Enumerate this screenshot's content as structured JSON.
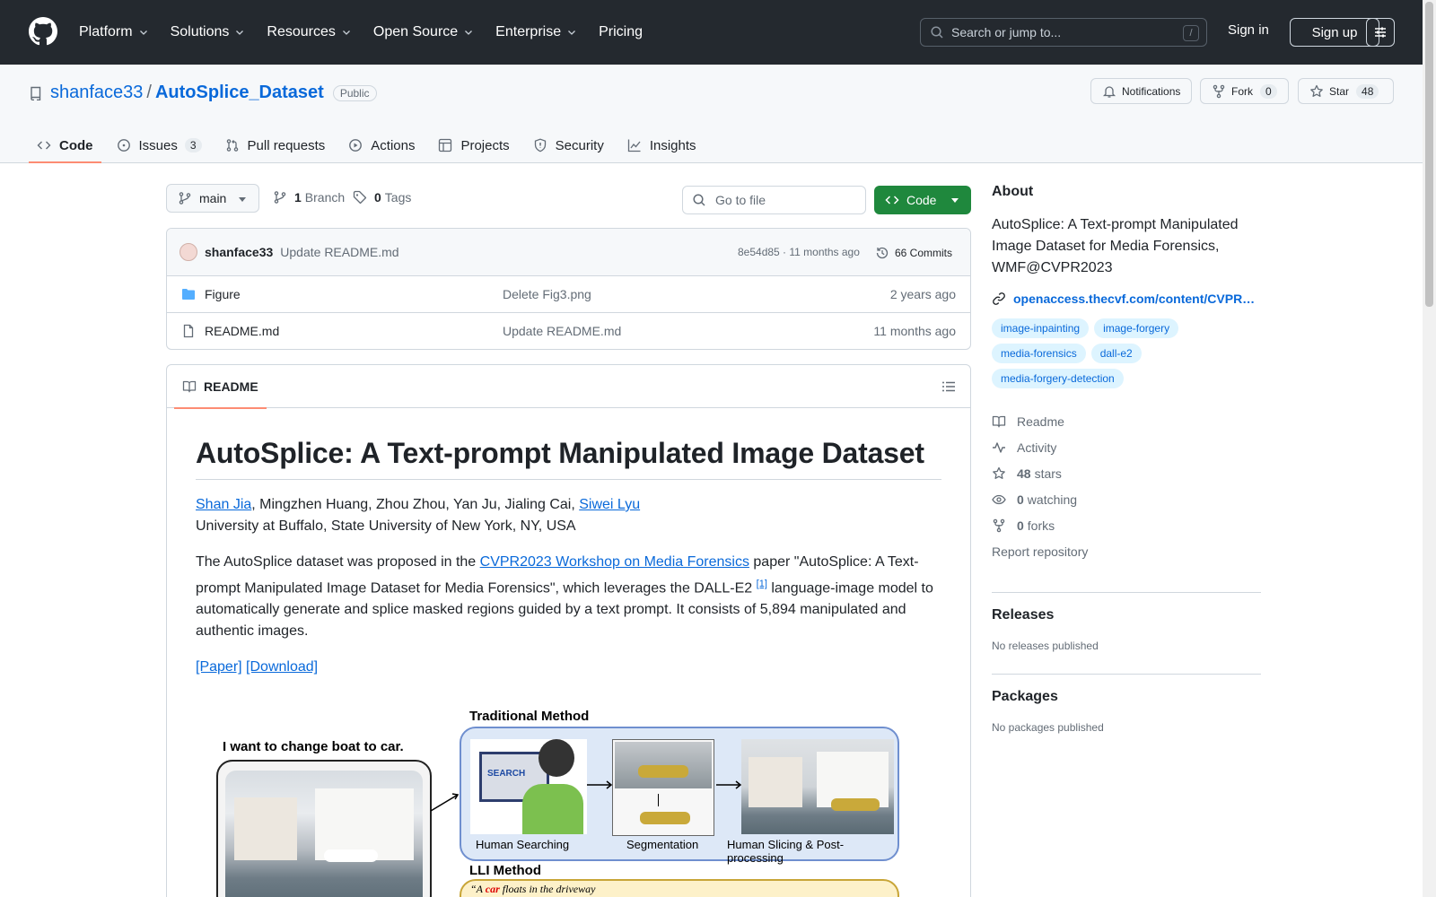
{
  "header": {
    "nav": [
      "Platform",
      "Solutions",
      "Resources",
      "Open Source",
      "Enterprise",
      "Pricing"
    ],
    "search_placeholder": "Search or jump to...",
    "search_shortcut": "/",
    "signin": "Sign in",
    "signup": "Sign up"
  },
  "repo": {
    "owner": "shanface33",
    "separator": "/",
    "name": "AutoSplice_Dataset",
    "visibility": "Public",
    "notifications_label": "Notifications",
    "fork_label": "Fork",
    "fork_count": "0",
    "star_label": "Star",
    "star_count": "48"
  },
  "tabs": [
    {
      "label": "Code",
      "icon": "code-icon"
    },
    {
      "label": "Issues",
      "icon": "issue-icon",
      "count": "3"
    },
    {
      "label": "Pull requests",
      "icon": "pull-request-icon"
    },
    {
      "label": "Actions",
      "icon": "play-icon"
    },
    {
      "label": "Projects",
      "icon": "table-icon"
    },
    {
      "label": "Security",
      "icon": "shield-icon"
    },
    {
      "label": "Insights",
      "icon": "graph-icon"
    }
  ],
  "toolbar": {
    "branch": "main",
    "branch_count": "1",
    "branch_label": "Branch",
    "tag_count": "0",
    "tag_label": "Tags",
    "goto_placeholder": "Go to file",
    "code_label": "Code"
  },
  "commit": {
    "author": "shanface33",
    "message": "Update README.md",
    "hash_time": "8e54d85 · 11 months ago",
    "commits": "66 Commits"
  },
  "files": [
    {
      "name": "Figure",
      "type": "folder",
      "message": "Delete Fig3.png",
      "date": "2 years ago"
    },
    {
      "name": "README.md",
      "type": "file",
      "message": "Update README.md",
      "date": "11 months ago"
    }
  ],
  "readme": {
    "tab_label": "README",
    "title": "AutoSplice: A Text-prompt Manipulated Image Dataset",
    "authors_link1": "Shan Jia",
    "authors_mid": ", Mingzhen Huang, Zhou Zhou, Yan Ju, Jialing Cai, ",
    "authors_link2": "Siwei Lyu",
    "affiliation": "University at Buffalo, State University of New York, NY, USA",
    "para_start": "The AutoSplice dataset was proposed in the ",
    "para_link": "CVPR2023 Workshop on Media Forensics",
    "para_mid": " paper \"AutoSplice: A Text-prompt Manipulated Image Dataset for Media Forensics\", which leverages the DALL-E2 ",
    "para_ref": "[1]",
    "para_end": " language-image model to automatically generate and splice masked regions guided by a text prompt. It consists of 5,894 manipulated and authentic images.",
    "link_paper": "[Paper]",
    "link_download": "[Download]",
    "figure": {
      "left_title": "I want to change boat to car.",
      "trad_title": "Traditional Method",
      "cap1": "Human Searching",
      "cap2": "Segmentation",
      "cap3": "Human Slicing & Post-processing",
      "lli_title": "LLI Method",
      "lli_prompt_pre": "“A ",
      "lli_prompt_car": "car",
      "lli_prompt_post": " floats in the driveway",
      "search_word": "SEARCH"
    }
  },
  "sidebar": {
    "about_title": "About",
    "description": "AutoSplice: A Text-prompt Manipulated Image Dataset for Media Forensics, WMF@CVPR2023",
    "website": "openaccess.thecvf.com/content/CVPR…",
    "topics": [
      "image-inpainting",
      "image-forgery",
      "media-forensics",
      "dall-e2",
      "media-forgery-detection"
    ],
    "readme_label": "Readme",
    "activity_label": "Activity",
    "stars_count": "48",
    "stars_label": "stars",
    "watching_count": "0",
    "watching_label": "watching",
    "forks_count": "0",
    "forks_label": "forks",
    "report": "Report repository",
    "releases_title": "Releases",
    "releases_text": "No releases published",
    "packages_title": "Packages",
    "packages_text": "No packages published"
  },
  "colors": {
    "header_bg": "#24292f",
    "accent_link": "#0969da",
    "code_button": "#1f883d",
    "active_tab_underline": "#fd8c73"
  }
}
